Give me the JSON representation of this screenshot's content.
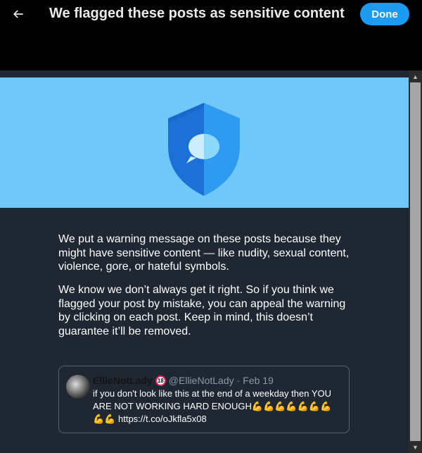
{
  "header": {
    "back_icon": "arrow-left-icon",
    "title": "We flagged these posts as sensitive content",
    "done_label": "Done"
  },
  "hero": {
    "icon": "shield-chat-icon",
    "colors": {
      "background": "#71c7f7",
      "shield_dark": "#1d70d6",
      "shield_light": "#2f9bf0"
    }
  },
  "body": {
    "paragraph1": "We put a warning message on these posts because they might have sensitive content — like nudity, sexual content, violence, gore, or hateful symbols.",
    "paragraph2": "We know we don’t always get it right. So if you think we flagged your post by mistake, you can appeal the warning by clicking on each post. Keep in mind, this doesn’t guarantee it’ll be removed."
  },
  "tweet": {
    "display_name": "EllieNotLady",
    "badge": "18",
    "handle": "@EllieNotLady",
    "separator": "·",
    "date": "Feb 19",
    "text": "if you don't look like this at the end of a weekday then YOU ARE NOT WORKING HARD ENOUGH",
    "emoji_line1": "💪💪💪💪💪💪💪",
    "emoji_line2": "💪💪",
    "link": "https://t.co/oJkfla5x08"
  }
}
